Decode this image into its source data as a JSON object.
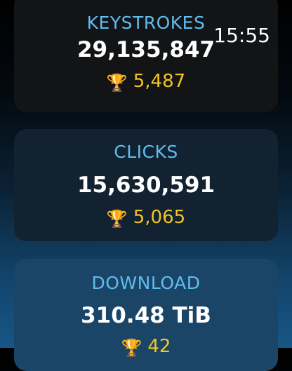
{
  "status_bar": {
    "time": "15:55"
  },
  "cards": [
    {
      "label": "KEYSTROKES",
      "value": "29,135,847",
      "rank": "5,487"
    },
    {
      "label": "CLICKS",
      "value": "15,630,591",
      "rank": "5,065"
    },
    {
      "label": "DOWNLOAD",
      "value": "310.48 TiB",
      "rank": "42"
    }
  ],
  "icons": {
    "rank_icon": "trophy-icon"
  },
  "colors": {
    "label": "#5ebdef",
    "value": "#ffffff",
    "rank": "#f3c623"
  }
}
